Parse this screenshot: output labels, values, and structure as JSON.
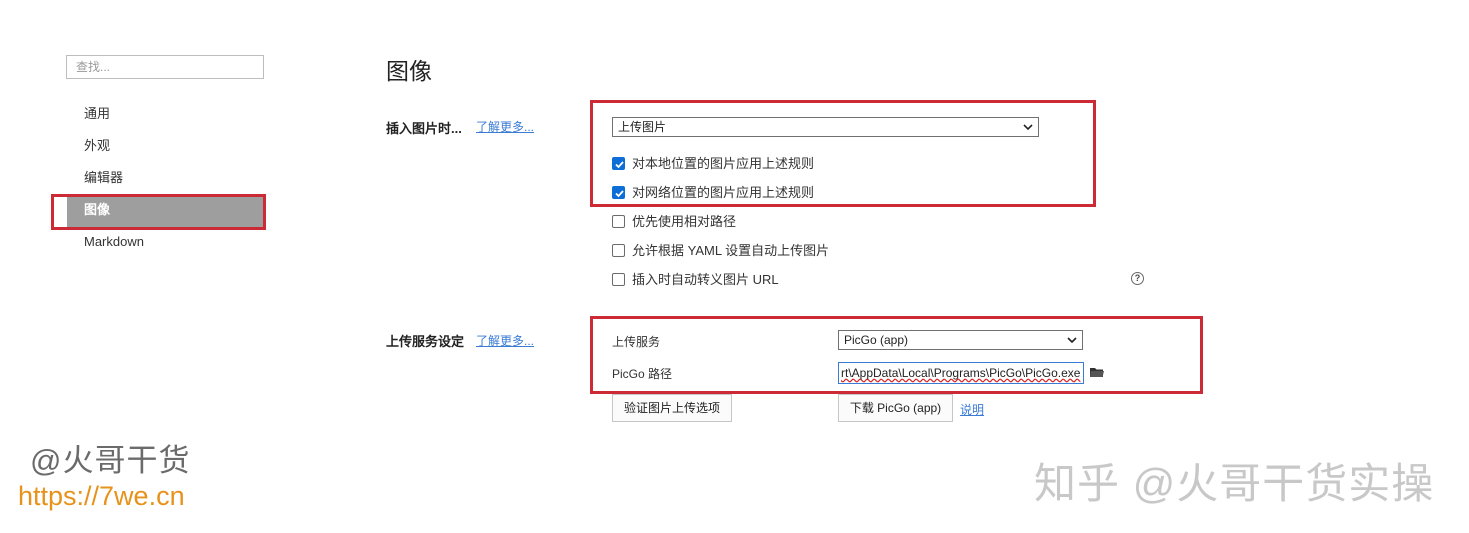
{
  "sidebar": {
    "search_placeholder": "查找...",
    "items": [
      {
        "label": "通用"
      },
      {
        "label": "外观"
      },
      {
        "label": "编辑器"
      },
      {
        "label": "图像"
      },
      {
        "label": "Markdown"
      }
    ],
    "active_index": 3
  },
  "main": {
    "title": "图像",
    "insert_section": {
      "label": "插入图片时...",
      "learn_more": "了解更多...",
      "select_value": "上传图片",
      "checkboxes": [
        {
          "label": "对本地位置的图片应用上述规则",
          "checked": true
        },
        {
          "label": "对网络位置的图片应用上述规则",
          "checked": true
        },
        {
          "label": "优先使用相对路径",
          "checked": false
        },
        {
          "label": "允许根据 YAML 设置自动上传图片",
          "checked": false
        },
        {
          "label": "插入时自动转义图片 URL",
          "checked": false
        }
      ],
      "help_icon": "?"
    },
    "upload_section": {
      "label": "上传服务设定",
      "learn_more": "了解更多...",
      "service_label": "上传服务",
      "service_value": "PicGo (app)",
      "path_label": "PicGo 路径",
      "path_value": "rt\\AppData\\Local\\Programs\\PicGo\\PicGo.exe",
      "verify_button": "验证图片上传选项",
      "download_button": "下载 PicGo (app)",
      "explain_link": "说明"
    }
  },
  "watermarks": {
    "left_name": "@火哥干货",
    "left_url": "https://7we.cn",
    "right": "知乎 @火哥干货实操"
  },
  "colors": {
    "highlight_red": "#cc2b36",
    "checkbox_blue": "#0d6ed8",
    "link_blue": "#3a7bd5",
    "active_nav_bg": "#9e9e9e",
    "url_orange": "#e7921a"
  },
  "icons": {
    "folder": "folder-icon",
    "dropdown": "chevron-down-icon",
    "help": "help-circle-icon",
    "check": "checkmark-icon"
  }
}
